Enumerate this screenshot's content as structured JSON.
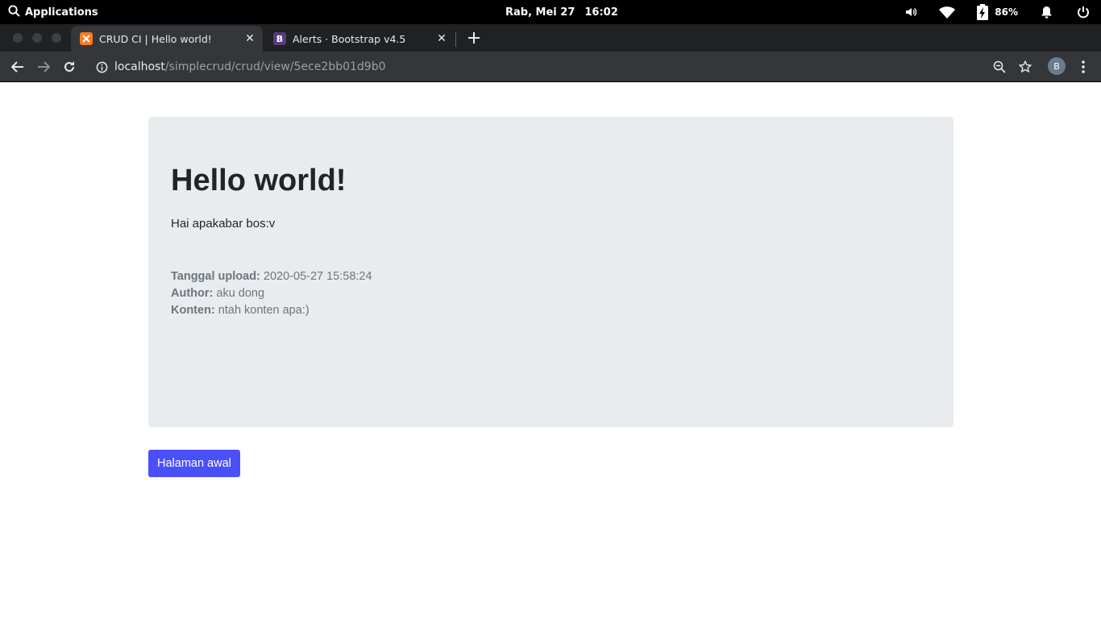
{
  "system": {
    "applications_label": "Applications",
    "date": "Rab, Mei 27",
    "time": "16:02",
    "battery": "86%"
  },
  "tabs": [
    {
      "title": "CRUD CI | Hello world!",
      "favicon": "xampp-icon",
      "active": true
    },
    {
      "title": "Alerts · Bootstrap v4.5",
      "favicon": "bootstrap-icon",
      "favicon_letter": "B",
      "active": false
    }
  ],
  "toolbar": {
    "url_host": "localhost",
    "url_path": "/simplecrud/crud/view/5ece2bb01d9b0",
    "profile_initial": "B"
  },
  "page": {
    "title": "Hello world!",
    "lead": "Hai apakabar bos:v",
    "meta": [
      {
        "label": "Tanggal upload:",
        "value": "2020-05-27 15:58:24"
      },
      {
        "label": "Author:",
        "value": "aku dong"
      },
      {
        "label": "Konten:",
        "value": "ntah konten apa:)"
      }
    ],
    "home_button": "Halaman awal"
  }
}
